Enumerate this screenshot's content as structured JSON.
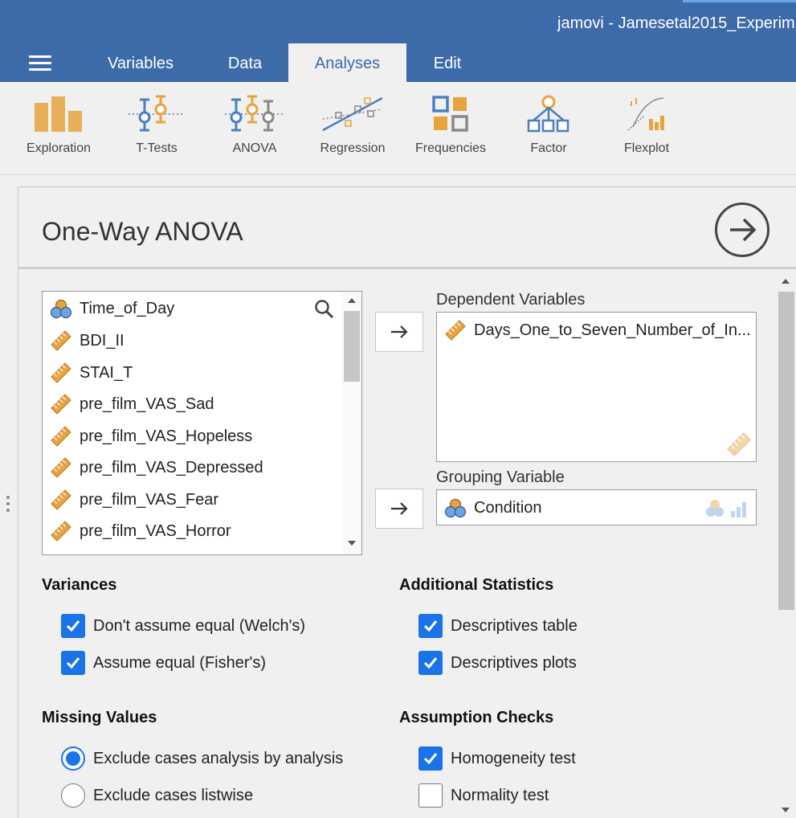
{
  "window": {
    "title": "jamovi - Jamesetal2015_Experim"
  },
  "tabs": [
    {
      "label": "Variables",
      "active": false
    },
    {
      "label": "Data",
      "active": false
    },
    {
      "label": "Analyses",
      "active": true
    },
    {
      "label": "Edit",
      "active": false
    }
  ],
  "ribbon": {
    "items": [
      {
        "label": "Exploration",
        "icon": "exploration-icon"
      },
      {
        "label": "T-Tests",
        "icon": "t-tests-icon"
      },
      {
        "label": "ANOVA",
        "icon": "anova-icon"
      },
      {
        "label": "Regression",
        "icon": "regression-icon"
      },
      {
        "label": "Frequencies",
        "icon": "frequencies-icon"
      },
      {
        "label": "Factor",
        "icon": "factor-icon"
      },
      {
        "label": "Flexplot",
        "icon": "flexplot-icon"
      }
    ]
  },
  "analysis": {
    "title": "One-Way ANOVA",
    "variables": [
      {
        "name": "Time_of_Day",
        "type": "nominal"
      },
      {
        "name": "BDI_II",
        "type": "continuous"
      },
      {
        "name": "STAI_T",
        "type": "continuous"
      },
      {
        "name": "pre_film_VAS_Sad",
        "type": "continuous"
      },
      {
        "name": "pre_film_VAS_Hopeless",
        "type": "continuous"
      },
      {
        "name": "pre_film_VAS_Depressed",
        "type": "continuous"
      },
      {
        "name": "pre_film_VAS_Fear",
        "type": "continuous"
      },
      {
        "name": "pre_film_VAS_Horror",
        "type": "continuous"
      }
    ],
    "dependent": {
      "label": "Dependent Variables",
      "items": [
        "Days_One_to_Seven_Number_of_In..."
      ]
    },
    "grouping": {
      "label": "Grouping Variable",
      "value": "Condition"
    },
    "variances": {
      "heading": "Variances",
      "options": [
        {
          "label": "Don't assume equal (Welch's)",
          "checked": true
        },
        {
          "label": "Assume equal (Fisher's)",
          "checked": true
        }
      ]
    },
    "additional": {
      "heading": "Additional Statistics",
      "options": [
        {
          "label": "Descriptives table",
          "checked": true
        },
        {
          "label": "Descriptives plots",
          "checked": true
        }
      ]
    },
    "missing": {
      "heading": "Missing Values",
      "options": [
        {
          "label": "Exclude cases analysis by analysis",
          "selected": true
        },
        {
          "label": "Exclude cases listwise",
          "selected": false
        }
      ]
    },
    "assumptions": {
      "heading": "Assumption Checks",
      "options": [
        {
          "label": "Homogeneity test",
          "checked": true
        },
        {
          "label": "Normality test",
          "checked": false
        }
      ]
    }
  },
  "colors": {
    "header": "#3d6aa8",
    "accent": "#1a73e8",
    "icon_orange": "#e8a33d",
    "icon_blue": "#4a7fc1"
  }
}
